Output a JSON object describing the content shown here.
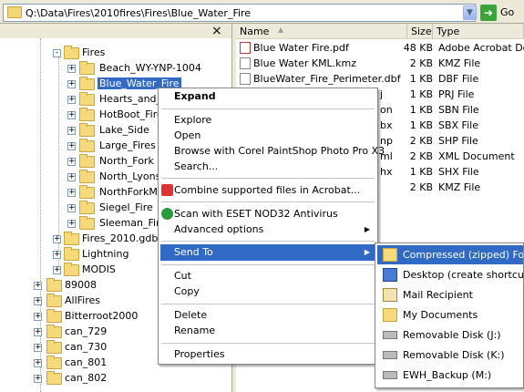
{
  "address": {
    "path": "Q:\\Data\\Fires\\2010fires\\Fires\\Blue_Water_Fire",
    "go_label": "Go"
  },
  "tree": {
    "close_glyph": "×",
    "items": [
      {
        "label": "Fires",
        "expander": "-"
      },
      {
        "label": "Beach_WY-YNP-1004",
        "expander": "+"
      },
      {
        "label": "Blue_Water_Fire",
        "expander": "+"
      },
      {
        "label": "Hearts_and_",
        "expander": "+"
      },
      {
        "label": "HotBoot_Fire",
        "expander": "+"
      },
      {
        "label": "Lake_Side",
        "expander": "+"
      },
      {
        "label": "Large_Fires",
        "expander": "+"
      },
      {
        "label": "North_Fork",
        "expander": "+"
      },
      {
        "label": "North_Lyons",
        "expander": "+"
      },
      {
        "label": "NorthForkMu",
        "expander": "+"
      },
      {
        "label": "Siegel_Fire",
        "expander": "+"
      },
      {
        "label": "Sleeman_Fire",
        "expander": "+"
      },
      {
        "label": "Fires_2010.gdb",
        "expander": "+"
      },
      {
        "label": "Lightning",
        "expander": "+"
      },
      {
        "label": "MODIS",
        "expander": "+"
      },
      {
        "label": "89008",
        "expander": "+"
      },
      {
        "label": "AllFires",
        "expander": "+"
      },
      {
        "label": "Bitterroot2000",
        "expander": "+"
      },
      {
        "label": "can_729",
        "expander": "+"
      },
      {
        "label": "can_730",
        "expander": "+"
      },
      {
        "label": "can_801",
        "expander": "+"
      },
      {
        "label": "can_802",
        "expander": "+"
      }
    ]
  },
  "list": {
    "columns": {
      "name": "Name",
      "size": "Size",
      "type": "Type"
    },
    "sort_glyph": "▲",
    "rows": [
      {
        "name": "Blue Water Fire.pdf",
        "size": "48 KB",
        "type": "Adobe Acrobat Doc"
      },
      {
        "name": "Blue Water KML.kmz",
        "size": "2 KB",
        "type": "KMZ File"
      },
      {
        "name": "BlueWater_Fire_Perimeter.dbf",
        "size": "1 KB",
        "type": "DBF File"
      },
      {
        "name": "j",
        "size": "1 KB",
        "type": "PRJ File"
      },
      {
        "name": "on",
        "size": "1 KB",
        "type": "SBN File"
      },
      {
        "name": "bx",
        "size": "1 KB",
        "type": "SBX File"
      },
      {
        "name": "np",
        "size": "2 KB",
        "type": "SHP File"
      },
      {
        "name": "ml",
        "size": "2 KB",
        "type": "XML Document"
      },
      {
        "name": "hx",
        "size": "1 KB",
        "type": "SHX File"
      },
      {
        "name": "",
        "size": "2 KB",
        "type": "KMZ File"
      }
    ]
  },
  "context_menu": {
    "expand": "Expand",
    "explore": "Explore",
    "open": "Open",
    "browse_corel": "Browse with Corel PaintShop Photo Pro X3",
    "search": "Search...",
    "combine_acrobat": "Combine supported files in Acrobat...",
    "scan_eset": "Scan with ESET NOD32 Antivirus",
    "advanced_options": "Advanced options",
    "send_to": "Send To",
    "cut": "Cut",
    "copy": "Copy",
    "delete": "Delete",
    "rename": "Rename",
    "properties": "Properties",
    "arrow_glyph": "▶"
  },
  "send_to_menu": {
    "items": [
      {
        "label": "Compressed (zipped) Folder",
        "icon": "zip-folder-icon"
      },
      {
        "label": "Desktop (create shortcut)",
        "icon": "desktop-icon"
      },
      {
        "label": "Mail Recipient",
        "icon": "mail-icon"
      },
      {
        "label": "My Documents",
        "icon": "my-documents-icon"
      },
      {
        "label": "Removable Disk (J:)",
        "icon": "removable-disk-icon"
      },
      {
        "label": "Removable Disk (K:)",
        "icon": "removable-disk-icon"
      },
      {
        "label": "EWH_Backup (M:)",
        "icon": "removable-disk-icon"
      }
    ]
  },
  "colors": {
    "selection": "#316ac5",
    "folder": "#f5d97b",
    "chrome": "#ece9d8"
  }
}
